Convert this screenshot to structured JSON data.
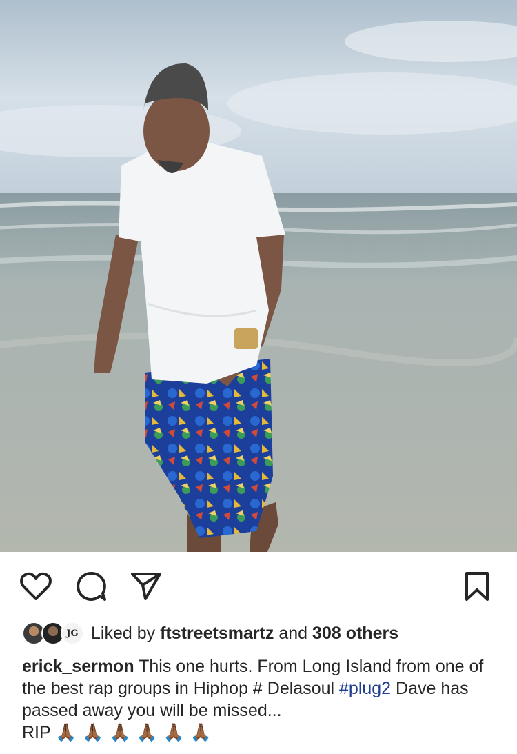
{
  "post": {
    "image_alt": "Man in white t-shirt and patterned shorts walking on the beach at the shoreline"
  },
  "actions": {
    "like_icon": "heart-icon",
    "comment_icon": "comment-icon",
    "share_icon": "send-icon",
    "save_icon": "bookmark-icon"
  },
  "likes": {
    "prefix": "Liked by",
    "user": "ftstreetsmartz",
    "middle": "and",
    "count": "308 others",
    "avatar_badge": "JG"
  },
  "caption": {
    "username": "erick_sermon",
    "text_1": "This one hurts. From Long Island from one of the best rap groups in Hiphop # Delasoul ",
    "hashtag": "#plug2",
    "text_2": " Dave  has passed away  you will be missed...",
    "text_3": "RIP",
    "emoji": "🙏🏾🙏🏾🙏🏾🙏🏾🙏🏾🙏🏾"
  },
  "colors": {
    "text": "#262626",
    "hashtag": "#1f3f8f",
    "sky": "#c9d6e1",
    "sea": "#a3aeb0"
  }
}
